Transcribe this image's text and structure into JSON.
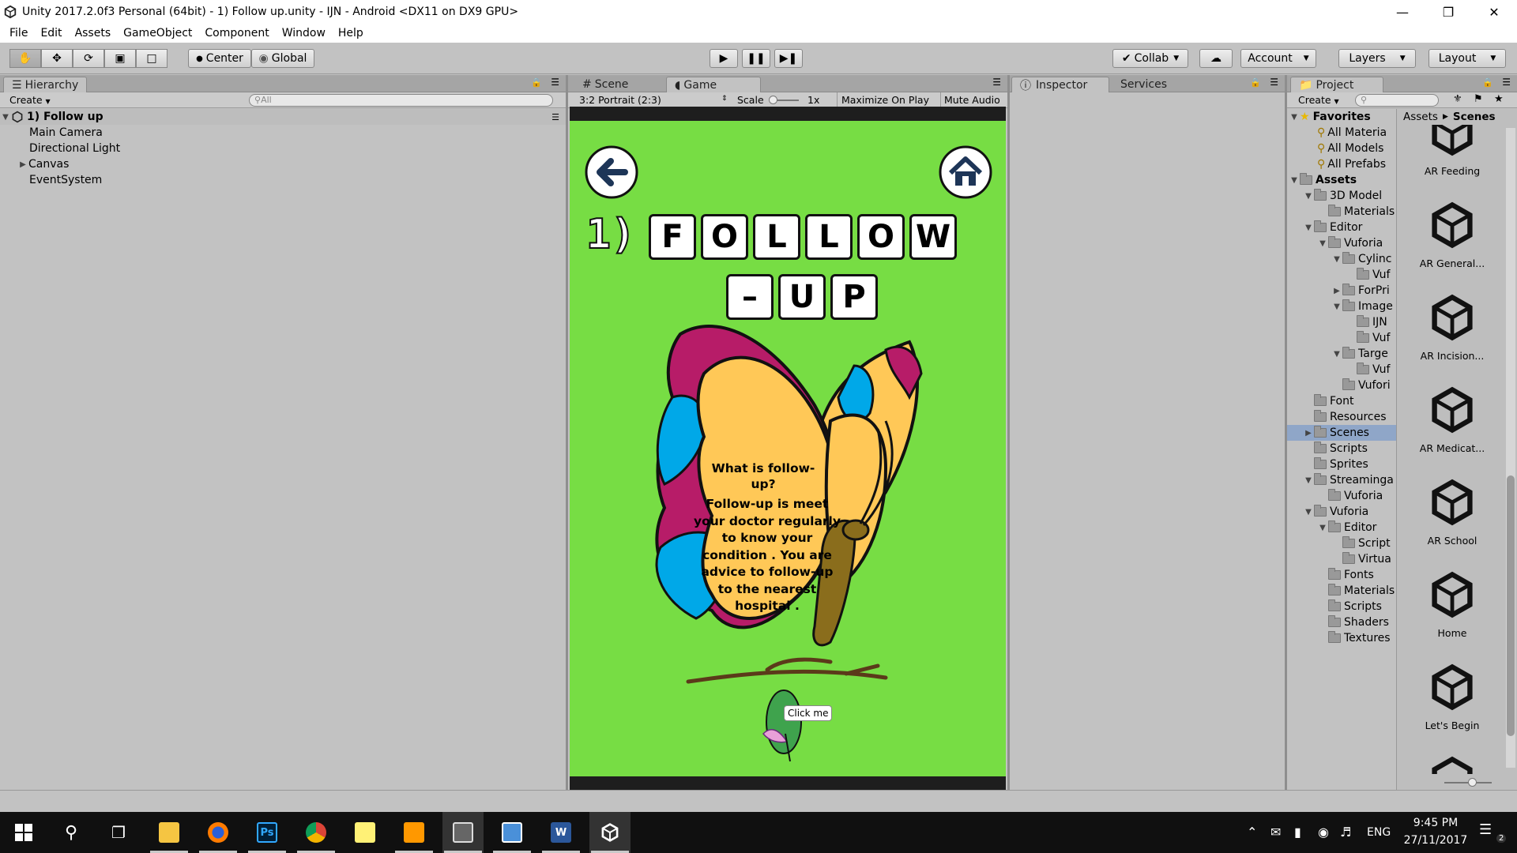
{
  "window": {
    "title": "Unity 2017.2.0f3 Personal (64bit) - 1) Follow up.unity - IJN - Android <DX11 on DX9 GPU>"
  },
  "menu": [
    "File",
    "Edit",
    "Assets",
    "GameObject",
    "Component",
    "Window",
    "Help"
  ],
  "toolbar": {
    "pivot": "Center",
    "space": "Global",
    "collab": "Collab",
    "account": "Account",
    "layers": "Layers",
    "layout": "Layout"
  },
  "hierarchy": {
    "tab": "Hierarchy",
    "create": "Create",
    "search_placeholder": "All",
    "scene": "1) Follow up",
    "items": [
      "Main Camera",
      "Directional Light",
      "Canvas",
      "EventSystem"
    ]
  },
  "game": {
    "tab_scene": "Scene",
    "tab_game": "Game",
    "aspect": "3:2 Portrait (2:3)",
    "scale_label": "Scale",
    "scale_value": "1x",
    "maximize": "Maximize On Play",
    "mute": "Mute Audio",
    "title_row1": [
      "1)",
      "F",
      "O",
      "L",
      "L",
      "O",
      "W"
    ],
    "title_row2": [
      "–",
      "U",
      "P"
    ],
    "question": "What is follow-up?",
    "answer": "Follow-up is meet your doctor regularly to know your condition . You are advice to follow-up to the nearest hospital .",
    "click_me": "Click me"
  },
  "inspector": {
    "tab": "Inspector",
    "tab_services": "Services"
  },
  "project": {
    "tab": "Project",
    "create": "Create",
    "breadcrumb": [
      "Assets",
      "Scenes"
    ],
    "favorites_label": "Favorites",
    "favorites": [
      "All Materia",
      "All Models",
      "All Prefabs"
    ],
    "tree": [
      {
        "label": "Assets",
        "level": 0,
        "arrow": "down",
        "bold": true
      },
      {
        "label": "3D Model",
        "level": 1,
        "arrow": "down"
      },
      {
        "label": "Materials",
        "level": 2,
        "arrow": ""
      },
      {
        "label": "Editor",
        "level": 1,
        "arrow": "down"
      },
      {
        "label": "Vuforia",
        "level": 2,
        "arrow": "down"
      },
      {
        "label": "Cylinc",
        "level": 3,
        "arrow": "down"
      },
      {
        "label": "Vuf",
        "level": 4,
        "arrow": ""
      },
      {
        "label": "ForPri",
        "level": 3,
        "arrow": "right"
      },
      {
        "label": "Image",
        "level": 3,
        "arrow": "down"
      },
      {
        "label": "IJN",
        "level": 4,
        "arrow": ""
      },
      {
        "label": "Vuf",
        "level": 4,
        "arrow": ""
      },
      {
        "label": "Targe",
        "level": 3,
        "arrow": "down"
      },
      {
        "label": "Vuf",
        "level": 4,
        "arrow": ""
      },
      {
        "label": "Vufori",
        "level": 3,
        "arrow": ""
      },
      {
        "label": "Font",
        "level": 1,
        "arrow": ""
      },
      {
        "label": "Resources",
        "level": 1,
        "arrow": ""
      },
      {
        "label": "Scenes",
        "level": 1,
        "arrow": "right",
        "selected": true
      },
      {
        "label": "Scripts",
        "level": 1,
        "arrow": ""
      },
      {
        "label": "Sprites",
        "level": 1,
        "arrow": ""
      },
      {
        "label": "Streaminga",
        "level": 1,
        "arrow": "down"
      },
      {
        "label": "Vuforia",
        "level": 2,
        "arrow": ""
      },
      {
        "label": "Vuforia",
        "level": 1,
        "arrow": "down"
      },
      {
        "label": "Editor",
        "level": 2,
        "arrow": "down"
      },
      {
        "label": "Script",
        "level": 3,
        "arrow": ""
      },
      {
        "label": "Virtua",
        "level": 3,
        "arrow": ""
      },
      {
        "label": "Fonts",
        "level": 2,
        "arrow": ""
      },
      {
        "label": "Materials",
        "level": 2,
        "arrow": ""
      },
      {
        "label": "Scripts",
        "level": 2,
        "arrow": ""
      },
      {
        "label": "Shaders",
        "level": 2,
        "arrow": ""
      },
      {
        "label": "Textures",
        "level": 2,
        "arrow": ""
      }
    ],
    "assets": [
      "AR Feeding",
      "AR General...",
      "AR Incision...",
      "AR Medicat...",
      "AR School",
      "Home",
      "Let's Begin"
    ]
  },
  "taskbar": {
    "lang": "ENG",
    "time": "9:45 PM",
    "date": "27/11/2017",
    "notifications": "2"
  }
}
